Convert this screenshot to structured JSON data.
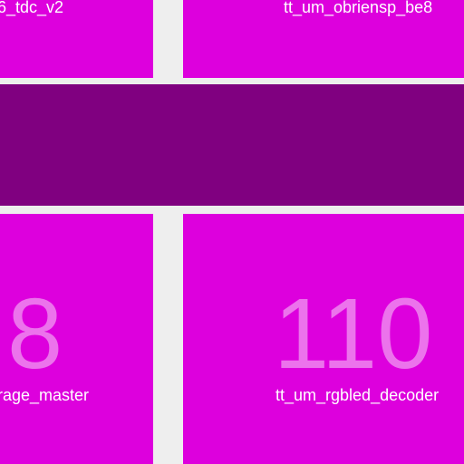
{
  "tiles": [
    {
      "title": "6_tdc_v2",
      "value": ""
    },
    {
      "title": "tt_um_obriensp_be8",
      "value": ""
    },
    {
      "title": "rage_master",
      "value": "8"
    },
    {
      "title": "tt_um_rgbled_decoder",
      "value": "110"
    }
  ],
  "colors": {
    "tile": "#dd00dd",
    "band": "#800080",
    "gap": "#eeeeee"
  }
}
